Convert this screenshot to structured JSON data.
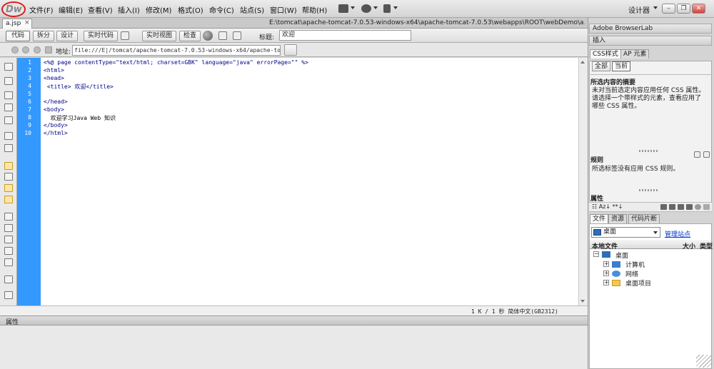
{
  "app": {
    "logo": "Dw",
    "menus": [
      "文件(F)",
      "编辑(E)",
      "查看(V)",
      "插入(I)",
      "修改(M)",
      "格式(O)",
      "命令(C)",
      "站点(S)",
      "窗口(W)",
      "帮助(H)"
    ],
    "workspace": "设计器",
    "window_controls": {
      "minimize": "–",
      "restore": "❐",
      "close": "✕"
    }
  },
  "document": {
    "tab_label": "a.jsp",
    "tab_close": "×",
    "file_path": "E:\\tomcat\\apache-tomcat-7.0.53-windows-x64\\apache-tomcat-7.0.53\\webapps\\ROOT\\webDemo\\a.jsp"
  },
  "doc_toolbar": {
    "code": "代码",
    "split": "拆分",
    "design": "设计",
    "live_code": "实时代码",
    "live_view": "实时视图",
    "inspect": "检查",
    "title_label": "标题:",
    "title_value": "欢迎"
  },
  "address_bar": {
    "label": "地址:",
    "value": "file:///E|/tomcat/apache-tomcat-7.0.53-windows-x64/apache-tomca"
  },
  "editor": {
    "line_numbers": [
      "1",
      "2",
      "3",
      "4",
      "5",
      "6",
      "7",
      "8",
      "9",
      "10"
    ],
    "lines": [
      "<%@ page contentType=\"text/html; charset=GBK\" language=\"java\" errorPage=\"\" %>",
      "<html>",
      "<head>",
      " <title> 欢迎</title>",
      "",
      "</head>",
      "<body>",
      "  欢迎学习Java Web 知识",
      "</body>",
      "</html>"
    ]
  },
  "status_bar": {
    "text": "1 K / 1 秒  简体中文(GB2312)"
  },
  "properties_panel": {
    "label": "属性"
  },
  "right_panels": {
    "browserlab": "Adobe BrowserLab",
    "insert": "插入",
    "css_tabs": [
      "CSS样式",
      "AP 元素"
    ],
    "mode_buttons": [
      "全部",
      "当前"
    ],
    "summary_title": "所选内容的摘要",
    "summary_text": "未对当前选定内容应用任何 CSS 属性。请选择一个带样式的元素，查看应用了哪些 CSS 属性。",
    "rules_title": "规则",
    "rules_text": "所选标签没有应用 CSS 规则。",
    "properties_title": "属性",
    "props_tools": "☷ Az↓ **↓",
    "files_tabs": [
      "文件",
      "资源",
      "代码片断"
    ],
    "site_select": "桌面",
    "manage_site": "管理站点",
    "files_columns": [
      "本地文件",
      "大小",
      "类型"
    ],
    "tree": [
      {
        "label": "桌面",
        "toggle": "−"
      },
      {
        "label": "计算机",
        "toggle": "+"
      },
      {
        "label": "网络",
        "toggle": "+"
      },
      {
        "label": "桌面项目",
        "toggle": "+"
      }
    ]
  }
}
